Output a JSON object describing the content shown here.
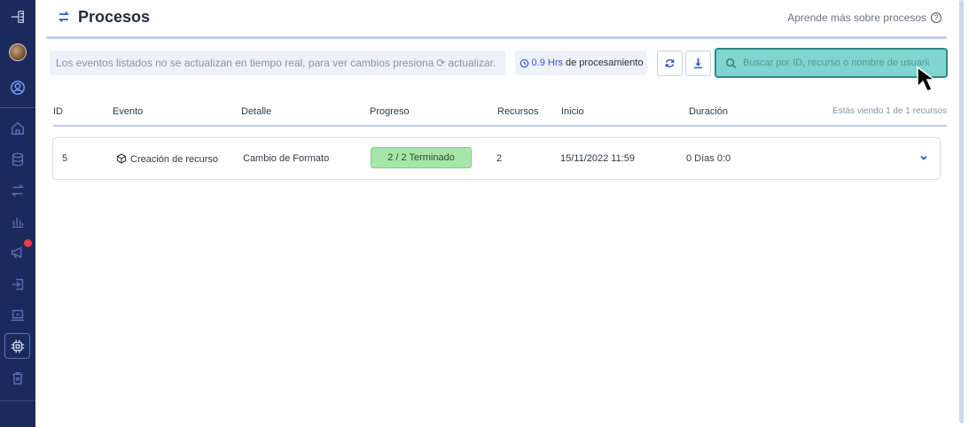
{
  "sidebar": {
    "items": [
      {
        "name": "menu-toggle-icon"
      },
      {
        "name": "avatar"
      },
      {
        "name": "user-circle-icon"
      },
      {
        "name": "home-icon"
      },
      {
        "name": "database-icon"
      },
      {
        "name": "transfer-arrows-icon"
      },
      {
        "name": "bar-chart-icon"
      },
      {
        "name": "megaphone-icon"
      },
      {
        "name": "sign-in-icon"
      },
      {
        "name": "laptop-icon"
      },
      {
        "name": "cpu-chip-icon"
      },
      {
        "name": "trash-icon"
      }
    ],
    "accent": "#1b2a5c",
    "notification_color": "#e83e4a"
  },
  "header": {
    "title": "Procesos",
    "learn_more": "Aprende más sobre procesos"
  },
  "toolbar": {
    "info_text_before": "Los eventos listados no se actualizan en tiempo real, para ver cambios presiona",
    "info_text_after": "actualizar.",
    "hours_value": "0.9 Hrs",
    "hours_label": "de procesamiento",
    "search_placeholder": "Buscar por ID, recurso o nombre de usuario"
  },
  "table": {
    "columns": [
      "ID",
      "Evento",
      "Detalle",
      "Progreso",
      "Recursos",
      "Inicio",
      "Duración"
    ],
    "records_info": "Estás viendo 1 de 1 recursos",
    "rows": [
      {
        "id": "5",
        "event": "Creación de recurso",
        "detail": "Cambio de Formato",
        "progress": "2 / 2 Terminado",
        "progress_fraction": 1.0,
        "resources": "2",
        "start": "15/11/2022 11:59",
        "duration": "0 Días 0:0"
      }
    ]
  },
  "colors": {
    "primary": "#2f55d4",
    "search_bg": "#80d5d0",
    "progress_bg": "#a6e6a8"
  }
}
